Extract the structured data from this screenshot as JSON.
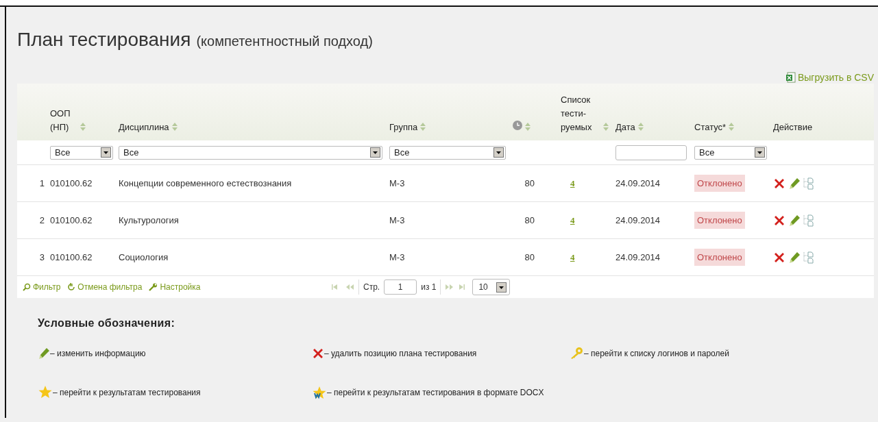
{
  "page": {
    "title": "План тестирования",
    "subtitle": "(компетентностный подход)",
    "export_link": "Выгрузить в CSV"
  },
  "table": {
    "columns": [
      {
        "kind": "number",
        "sortable": false
      },
      {
        "kind": "text",
        "label": "ООП (НП)",
        "sortable": true,
        "filter": {
          "kind": "select",
          "value": "Все"
        }
      },
      {
        "kind": "text",
        "label": "Дисциплина",
        "sortable": true,
        "filter": {
          "kind": "select",
          "value": "Все"
        }
      },
      {
        "kind": "text",
        "label": "Группа",
        "sortable": true,
        "filter": {
          "kind": "select",
          "value": "Все"
        }
      },
      {
        "kind": "clock",
        "sortable": true
      },
      {
        "kind": "text",
        "label": "Список тести-руемых",
        "sortable": true
      },
      {
        "kind": "text",
        "label": "Дата",
        "sortable": true,
        "filter": {
          "kind": "input"
        }
      },
      {
        "kind": "text",
        "label": "Статус*",
        "sortable": true,
        "filter": {
          "kind": "select",
          "value": "Все"
        }
      },
      {
        "kind": "text",
        "label": "Действие",
        "sortable": false
      }
    ],
    "rows": [
      {
        "num": "1",
        "oop": "010100.62",
        "discipline": "Концепции современного естествознания",
        "group": "М-3",
        "duration": "80",
        "tested": "4",
        "date": "24.09.2014",
        "status": "Отклонено"
      },
      {
        "num": "2",
        "oop": "010100.62",
        "discipline": "Культурология",
        "group": "М-3",
        "duration": "80",
        "tested": "4",
        "date": "24.09.2014",
        "status": "Отклонено"
      },
      {
        "num": "3",
        "oop": "010100.62",
        "discipline": "Социология",
        "group": "М-3",
        "duration": "80",
        "tested": "4",
        "date": "24.09.2014",
        "status": "Отклонено"
      }
    ],
    "footer": {
      "tools": [
        {
          "kind": "filter",
          "label": "Фильтр"
        },
        {
          "kind": "reset",
          "label": "Отмена фильтра"
        },
        {
          "kind": "settings",
          "label": "Настройка"
        }
      ],
      "pager": {
        "page_label": "Стр.",
        "page": "1",
        "total": "из 1",
        "page_size": "10",
        "nav_disabled": true
      }
    }
  },
  "legend": {
    "title": "Условные обозначения:",
    "items": [
      {
        "kind": "edit",
        "text": "– изменить информацию"
      },
      {
        "kind": "delete",
        "text": "– удалить позицию плана тестирования"
      },
      {
        "kind": "key",
        "text": "– перейти к списку логинов и паролей"
      },
      {
        "kind": "star",
        "text": "– перейти к результатам тестирования"
      },
      {
        "kind": "docx",
        "text": "– перейти к результатам тестирования в формате DOCX"
      }
    ]
  }
}
